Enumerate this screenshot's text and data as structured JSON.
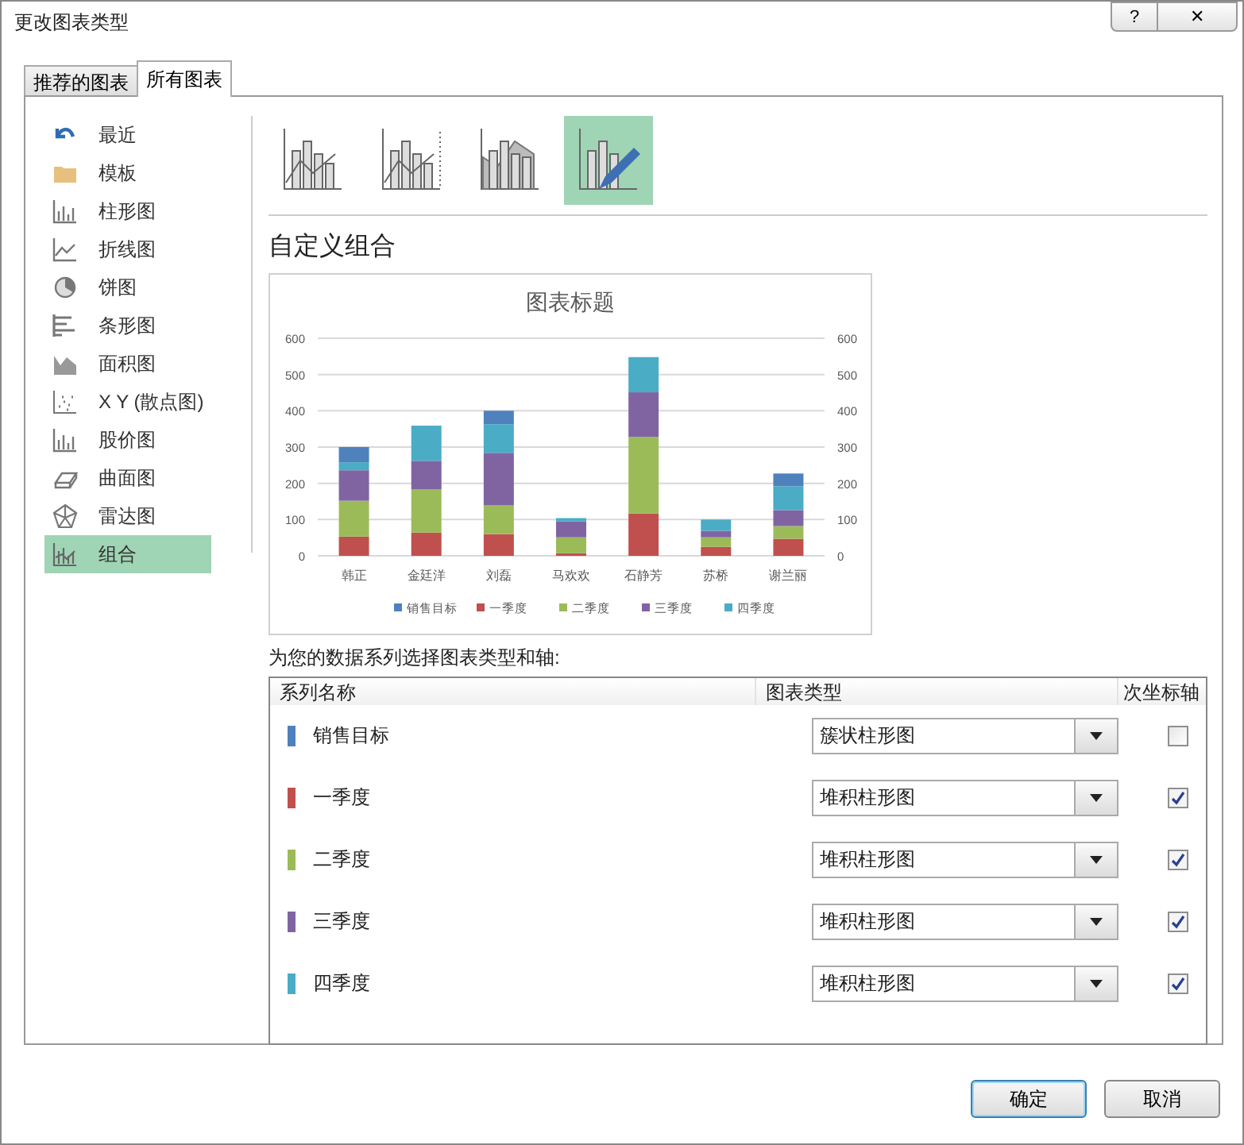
{
  "window": {
    "title": "更改图表类型",
    "help_button": "?",
    "close_button": "✕"
  },
  "tabs": [
    {
      "label": "推荐的图表",
      "selected": false
    },
    {
      "label": "所有图表",
      "selected": true
    }
  ],
  "sidebar": {
    "items": [
      {
        "label": "最近",
        "selected": false
      },
      {
        "label": "模板",
        "selected": false
      },
      {
        "label": "柱形图",
        "selected": false
      },
      {
        "label": "折线图",
        "selected": false
      },
      {
        "label": "饼图",
        "selected": false
      },
      {
        "label": "条形图",
        "selected": false
      },
      {
        "label": "面积图",
        "selected": false
      },
      {
        "label": "X Y (散点图)",
        "selected": false
      },
      {
        "label": "股价图",
        "selected": false
      },
      {
        "label": "曲面图",
        "selected": false
      },
      {
        "label": "雷达图",
        "selected": false
      },
      {
        "label": "组合",
        "selected": true
      }
    ]
  },
  "subtypes": [
    {
      "selected": false
    },
    {
      "selected": false
    },
    {
      "selected": false
    },
    {
      "selected": true
    }
  ],
  "section_title": "自定义组合",
  "preview": {
    "chart_data": {
      "type": "bar",
      "title": "图表标题",
      "categories": [
        "韩正",
        "金廷洋",
        "刘磊",
        "马欢欢",
        "石静芳",
        "苏桥",
        "谢兰丽"
      ],
      "stacked": true,
      "ylim": [
        0,
        600
      ],
      "yticks": [
        0,
        100,
        200,
        300,
        400,
        500,
        600
      ],
      "y2ticks": [
        0,
        100,
        200,
        300,
        400,
        500,
        600
      ],
      "y2lim": [
        0,
        600
      ],
      "grid": true,
      "legend": "bottom",
      "series": [
        {
          "name": "销售目标",
          "color": "#4f81bd",
          "values": [
            42,
            null,
            37,
            null,
            null,
            null,
            35
          ]
        },
        {
          "name": "一季度",
          "color": "#c0504d",
          "values": [
            53,
            64,
            60,
            7,
            117,
            25,
            47
          ]
        },
        {
          "name": "二季度",
          "color": "#9bbb59",
          "values": [
            99,
            119,
            79,
            44,
            211,
            26,
            35
          ]
        },
        {
          "name": "三季度",
          "color": "#8064a2",
          "values": [
            84,
            79,
            145,
            44,
            123,
            18,
            44
          ]
        },
        {
          "name": "四季度",
          "color": "#4bacc6",
          "values": [
            22,
            97,
            79,
            9,
            97,
            31,
            66
          ]
        }
      ]
    }
  },
  "prompt": "为您的数据系列选择图表类型和轴:",
  "series_table": {
    "columns": [
      "系列名称",
      "图表类型",
      "次坐标轴"
    ],
    "rows": [
      {
        "name": "销售目标",
        "color": "#4f81bd",
        "chart_type": "簇状柱形图",
        "secondary_axis": false
      },
      {
        "name": "一季度",
        "color": "#c0504d",
        "chart_type": "堆积柱形图",
        "secondary_axis": true
      },
      {
        "name": "二季度",
        "color": "#9bbb59",
        "chart_type": "堆积柱形图",
        "secondary_axis": true
      },
      {
        "name": "三季度",
        "color": "#8064a2",
        "chart_type": "堆积柱形图",
        "secondary_axis": true
      },
      {
        "name": "四季度",
        "color": "#4bacc6",
        "chart_type": "堆积柱形图",
        "secondary_axis": true
      }
    ]
  },
  "buttons": [
    {
      "label": "确定",
      "default": true
    },
    {
      "label": "取消",
      "default": false
    }
  ]
}
